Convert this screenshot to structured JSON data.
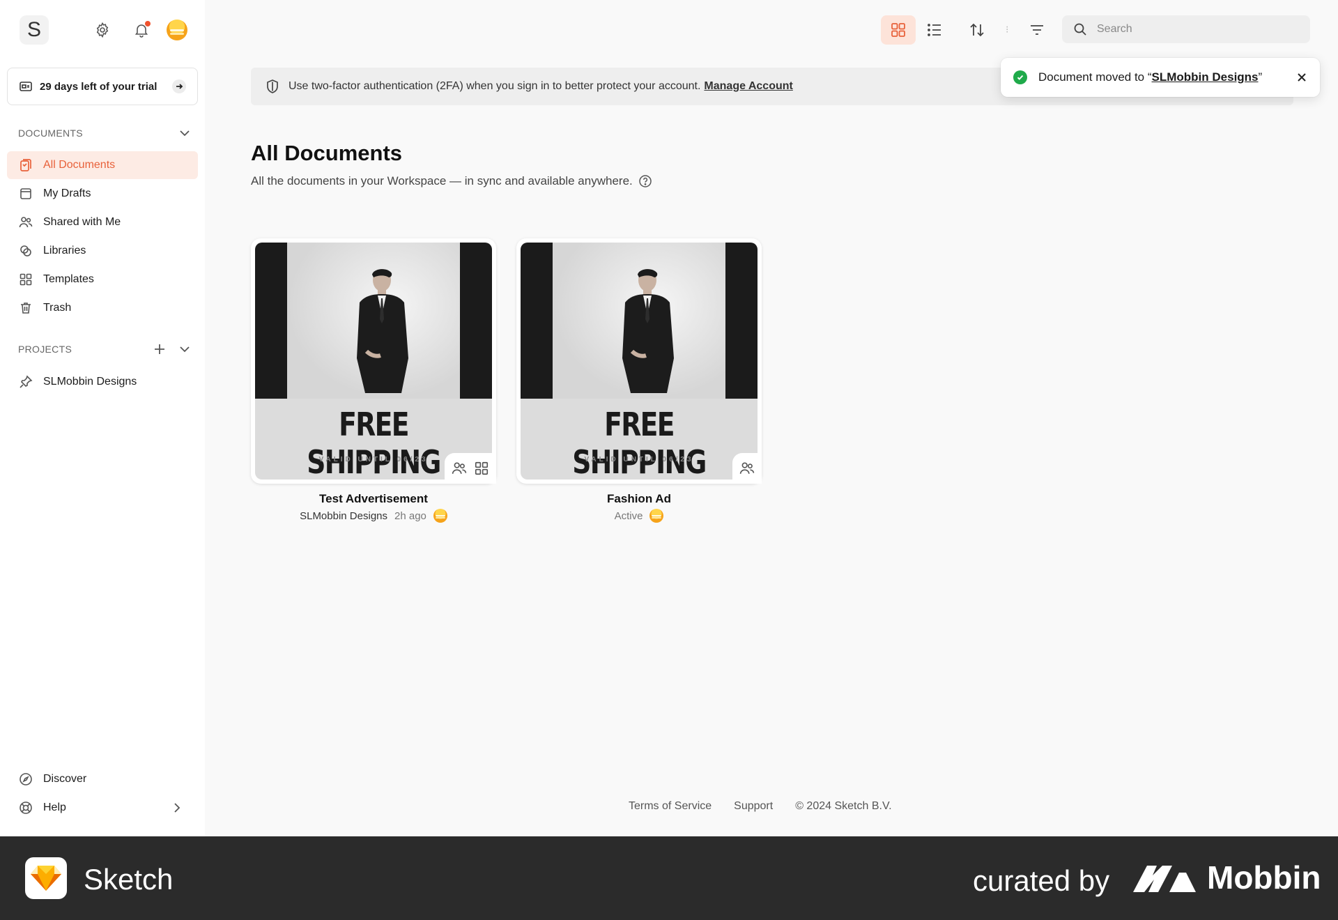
{
  "sidebar": {
    "logo_letter": "S",
    "trial_label": "29 days left of your trial",
    "documents_heading": "DOCUMENTS",
    "documents": [
      {
        "label": "All Documents",
        "icon": "all-documents-icon",
        "active": true
      },
      {
        "label": "My Drafts",
        "icon": "drafts-icon",
        "active": false
      },
      {
        "label": "Shared with Me",
        "icon": "people-icon",
        "active": false
      },
      {
        "label": "Libraries",
        "icon": "libraries-icon",
        "active": false
      },
      {
        "label": "Templates",
        "icon": "templates-icon",
        "active": false
      },
      {
        "label": "Trash",
        "icon": "trash-icon",
        "active": false
      }
    ],
    "projects_heading": "PROJECTS",
    "projects": [
      {
        "label": "SLMobbin Designs",
        "icon": "pin-icon"
      }
    ],
    "bottom": [
      {
        "label": "Discover",
        "icon": "compass-icon"
      },
      {
        "label": "Help",
        "icon": "lifebuoy-icon"
      }
    ]
  },
  "toolbar": {
    "search_placeholder": "Search",
    "separator": "⁝"
  },
  "banner": {
    "text": "Use two-factor authentication (2FA) when you sign in to better protect your account.",
    "link": "Manage Account"
  },
  "toast": {
    "prefix": "Document moved to “",
    "project": "SLMobbin Designs",
    "suffix": "”"
  },
  "main": {
    "title": "All Documents",
    "subtitle": "All the documents in your Workspace — in sync and available anywhere."
  },
  "documents": [
    {
      "name": "Test Advertisement",
      "project": "SLMobbin Designs",
      "time": "2h ago",
      "thumb_headline": "FREE SHIPPING",
      "thumb_valid": "VALID UNTIL 06/23"
    },
    {
      "name": "Fashion Ad",
      "status": "Active",
      "thumb_headline": "FREE SHIPPING",
      "thumb_valid": "VALID UNTIL 06/23"
    }
  ],
  "footer": {
    "terms": "Terms of Service",
    "support": "Support",
    "copyright": "© 2024 Sketch B.V."
  },
  "branding": {
    "app_name": "Sketch",
    "curated_by": "curated by",
    "mobbin": "Mobbin"
  },
  "colors": {
    "accent": "#e8613a",
    "active_bg": "#fdebe4",
    "success": "#1faa4a",
    "brandbar": "#2b2b2b"
  }
}
